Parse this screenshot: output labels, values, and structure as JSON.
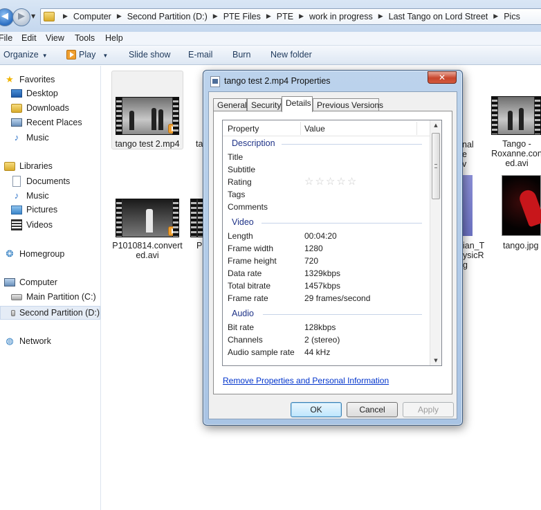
{
  "breadcrumbs": [
    "Computer",
    "Second Partition (D:)",
    "PTE Files",
    "PTE",
    "work in progress",
    "Last Tango on Lord Street",
    "Pics"
  ],
  "menu": [
    "File",
    "Edit",
    "View",
    "Tools",
    "Help"
  ],
  "toolbar": {
    "organize": "Organize",
    "play": "Play",
    "slideshow": "Slide show",
    "email": "E-mail",
    "burn": "Burn",
    "new_folder": "New folder"
  },
  "nav": {
    "favorites": "Favorites",
    "desktop": "Desktop",
    "downloads": "Downloads",
    "recent": "Recent Places",
    "music_fav": "Music",
    "libraries": "Libraries",
    "documents": "Documents",
    "music": "Music",
    "pictures": "Pictures",
    "videos": "Videos",
    "homegroup": "Homegroup",
    "computer": "Computer",
    "main_partition": "Main Partition (C:)",
    "second_partition": "Second Partition (D:)",
    "network": "Network"
  },
  "files": {
    "f1_name": "tango test 2.mp4",
    "f2_frag": "ta",
    "f3_line1": "P1010814.convert",
    "f3_line2": "ed.avi",
    "f4_frag": "P",
    "f5_line1": "Tango -",
    "f5_line2": "Roxanne.con",
    "f5_line3": "ed.avi",
    "f6_name": "tango.jpg",
    "partial_a1": "nal",
    "partial_a2": "e",
    "partial_a3": "v",
    "partial_b1": "ian_T",
    "partial_b2": "ysicR",
    "partial_b3": "g"
  },
  "dialog": {
    "title": "tango test 2.mp4 Properties",
    "close": "✕",
    "tabs": [
      "General",
      "Security",
      "Details",
      "Previous Versions"
    ],
    "col_property": "Property",
    "col_value": "Value",
    "group_description": "Description",
    "description_rows": [
      {
        "k": "Title",
        "v": ""
      },
      {
        "k": "Subtitle",
        "v": ""
      },
      {
        "k": "Rating",
        "v": ""
      },
      {
        "k": "Tags",
        "v": ""
      },
      {
        "k": "Comments",
        "v": ""
      }
    ],
    "rating_stars": 0,
    "group_video": "Video",
    "video_rows": [
      {
        "k": "Length",
        "v": "00:04:20"
      },
      {
        "k": "Frame width",
        "v": "1280"
      },
      {
        "k": "Frame height",
        "v": "720"
      },
      {
        "k": "Data rate",
        "v": "1329kbps"
      },
      {
        "k": "Total bitrate",
        "v": "1457kbps"
      },
      {
        "k": "Frame rate",
        "v": "29 frames/second"
      }
    ],
    "group_audio": "Audio",
    "audio_rows": [
      {
        "k": "Bit rate",
        "v": "128kbps"
      },
      {
        "k": "Channels",
        "v": "2 (stereo)"
      },
      {
        "k": "Audio sample rate",
        "v": "44 kHz"
      }
    ],
    "remove_link": "Remove Properties and Personal Information",
    "ok": "OK",
    "cancel": "Cancel",
    "apply": "Apply"
  }
}
